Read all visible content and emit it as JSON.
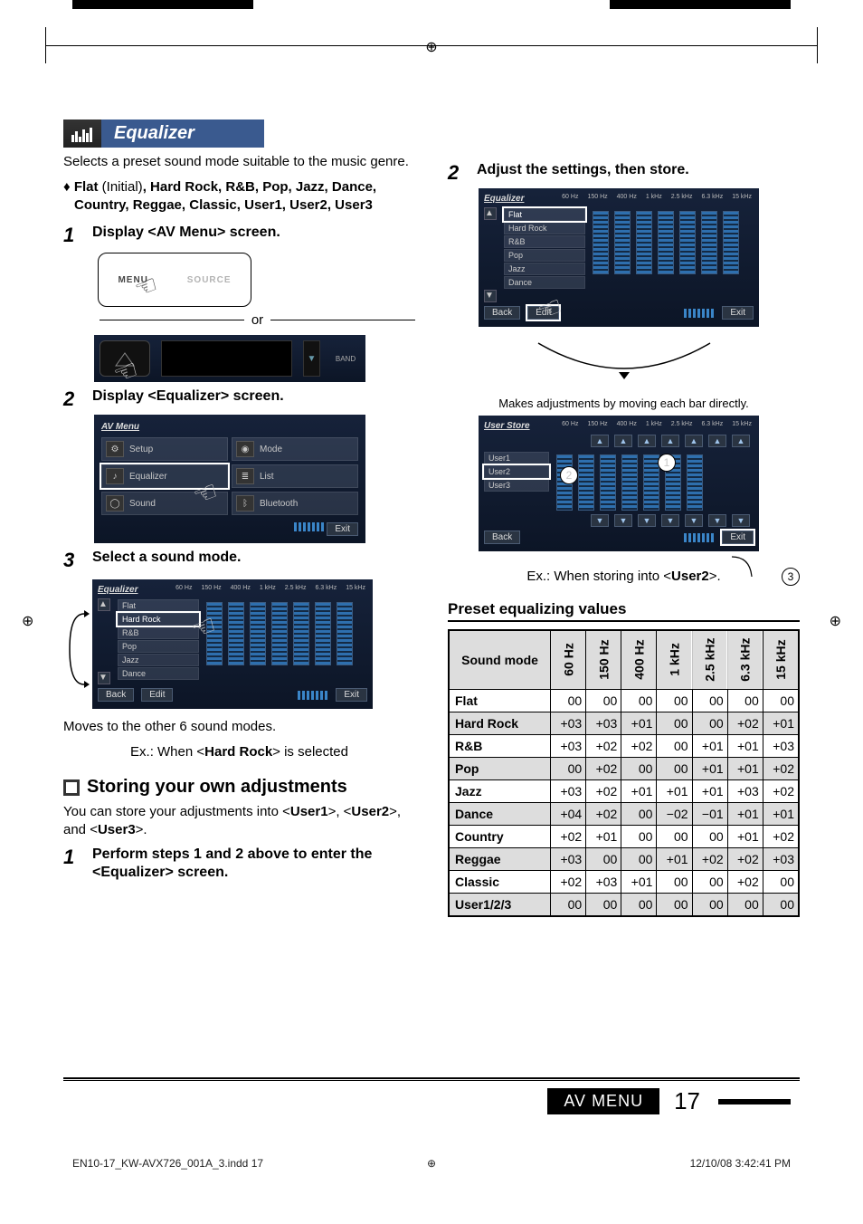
{
  "section": {
    "title": "Equalizer"
  },
  "intro": "Selects a preset sound mode suitable to the music genre.",
  "presets_bullet": "Flat (Initial), Hard Rock, R&B, Pop, Jazz, Dance, Country, Reggae, Classic, User1, User2, User3",
  "steps_left": {
    "s1": "Display <AV Menu> screen.",
    "or": "or",
    "remote_menu": "MENU",
    "remote_source": "SOURCE",
    "band": "BAND",
    "s2": "Display <Equalizer> screen.",
    "s3": "Select a sound mode."
  },
  "avmenu": {
    "title": "AV Menu",
    "setup": "Setup",
    "mode": "Mode",
    "equalizer": "Equalizer",
    "list": "List",
    "sound": "Sound",
    "bluetooth": "Bluetooth",
    "exit": "Exit"
  },
  "eqfreqs": [
    "60\nHz",
    "150\nHz",
    "400\nHz",
    "1\nkHz",
    "2.5\nkHz",
    "6.3\nkHz",
    "15\nkHz"
  ],
  "eqlist": [
    "Flat",
    "Hard Rock",
    "R&B",
    "Pop",
    "Jazz",
    "Dance"
  ],
  "eq_footer": {
    "back": "Back",
    "edit": "Edit",
    "exit": "Exit"
  },
  "eq_select_note1": "Moves to the other 6 sound modes.",
  "eq_select_note2_pre": "Ex.: When <",
  "eq_select_note2_bold": "Hard Rock",
  "eq_select_note2_post": "> is selected",
  "storing": {
    "heading": "Storing your own adjustments",
    "para_pre": "You can store your adjustments into <",
    "u1": "User1",
    "mid1": ">, <",
    "u2": "User2",
    "mid2": ">, and <",
    "u3": "User3",
    "post": ">.",
    "s1": "Perform steps 1 and 2 above to enter the <Equalizer> screen.",
    "s2": "Adjust the settings, then store."
  },
  "right_notes": {
    "makes": "Makes adjustments by moving each bar directly.",
    "userstore_title": "User Store",
    "user_list": [
      "User1",
      "User2",
      "User3"
    ],
    "exnote_pre": "Ex.: When storing into <",
    "exnote_bold": "User2",
    "exnote_post": ">."
  },
  "circles": {
    "c1": "1",
    "c2": "2",
    "c3": "3"
  },
  "table": {
    "title": "Preset equalizing values",
    "row_header": "Sound mode",
    "cols": [
      "60 Hz",
      "150 Hz",
      "400 Hz",
      "1 kHz",
      "2.5 kHz",
      "6.3 kHz",
      "15 kHz"
    ],
    "rows": [
      {
        "name": "Flat",
        "vals": [
          "00",
          "00",
          "00",
          "00",
          "00",
          "00",
          "00"
        ]
      },
      {
        "name": "Hard Rock",
        "vals": [
          "+03",
          "+03",
          "+01",
          "00",
          "00",
          "+02",
          "+01"
        ]
      },
      {
        "name": "R&B",
        "vals": [
          "+03",
          "+02",
          "+02",
          "00",
          "+01",
          "+01",
          "+03"
        ]
      },
      {
        "name": "Pop",
        "vals": [
          "00",
          "+02",
          "00",
          "00",
          "+01",
          "+01",
          "+02"
        ]
      },
      {
        "name": "Jazz",
        "vals": [
          "+03",
          "+02",
          "+01",
          "+01",
          "+01",
          "+03",
          "+02"
        ]
      },
      {
        "name": "Dance",
        "vals": [
          "+04",
          "+02",
          "00",
          "−02",
          "−01",
          "+01",
          "+01"
        ]
      },
      {
        "name": "Country",
        "vals": [
          "+02",
          "+01",
          "00",
          "00",
          "00",
          "+01",
          "+02"
        ]
      },
      {
        "name": "Reggae",
        "vals": [
          "+03",
          "00",
          "00",
          "+01",
          "+02",
          "+02",
          "+03"
        ]
      },
      {
        "name": "Classic",
        "vals": [
          "+02",
          "+03",
          "+01",
          "00",
          "00",
          "+02",
          "00"
        ]
      },
      {
        "name": "User1/2/3",
        "vals": [
          "00",
          "00",
          "00",
          "00",
          "00",
          "00",
          "00"
        ]
      }
    ]
  },
  "footer": {
    "section": "AV MENU",
    "page": "17"
  },
  "imprint": {
    "file": "EN10-17_KW-AVX726_001A_3.indd   17",
    "ts": "12/10/08   3:42:41 PM"
  },
  "chart_data": {
    "type": "table",
    "title": "Preset equalizing values",
    "columns": [
      "Sound mode",
      "60 Hz",
      "150 Hz",
      "400 Hz",
      "1 kHz",
      "2.5 kHz",
      "6.3 kHz",
      "15 kHz"
    ],
    "rows": [
      [
        "Flat",
        0,
        0,
        0,
        0,
        0,
        0,
        0
      ],
      [
        "Hard Rock",
        3,
        3,
        1,
        0,
        0,
        2,
        1
      ],
      [
        "R&B",
        3,
        2,
        2,
        0,
        1,
        1,
        3
      ],
      [
        "Pop",
        0,
        2,
        0,
        0,
        1,
        1,
        2
      ],
      [
        "Jazz",
        3,
        2,
        1,
        1,
        1,
        3,
        2
      ],
      [
        "Dance",
        4,
        2,
        0,
        -2,
        -1,
        1,
        1
      ],
      [
        "Country",
        2,
        1,
        0,
        0,
        0,
        1,
        2
      ],
      [
        "Reggae",
        3,
        0,
        0,
        1,
        2,
        2,
        3
      ],
      [
        "Classic",
        2,
        3,
        1,
        0,
        0,
        2,
        0
      ],
      [
        "User1/2/3",
        0,
        0,
        0,
        0,
        0,
        0,
        0
      ]
    ]
  }
}
